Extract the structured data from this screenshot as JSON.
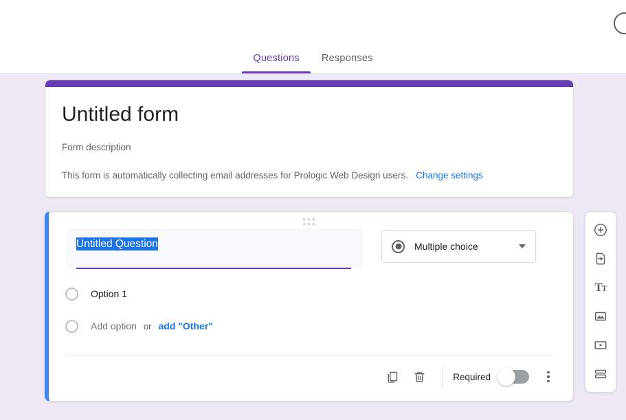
{
  "theme": {
    "accent_purple": "#673AB7",
    "accent_blue": "#4285F4",
    "link_blue": "#1a73e8",
    "page_background": "#EDE9F5"
  },
  "header": {
    "avatar_name": "account-avatar",
    "tabs": [
      {
        "label": "Questions",
        "active": true
      },
      {
        "label": "Responses",
        "active": false
      }
    ]
  },
  "form_header": {
    "title": "Untitled form",
    "description_placeholder": "Form description",
    "email_notice": "This form is automatically collecting email addresses for Prologic Web Design users.",
    "change_settings_link": "Change settings"
  },
  "question": {
    "drag_handle": "drag-handle",
    "title_text": "Untitled Question",
    "title_selected": true,
    "type": {
      "icon": "radio-button-icon",
      "label": "Multiple choice",
      "chevron": "chevron-down-icon"
    },
    "options": [
      {
        "label": "Option 1",
        "placeholder": false
      }
    ],
    "add_option": {
      "label": "Add option",
      "or": "or",
      "other_label": "add \"Other\""
    },
    "footer": {
      "duplicate_icon": "duplicate-icon",
      "delete_icon": "trash-icon",
      "required_label": "Required",
      "required_on": false,
      "more_icon": "more-vertical-icon"
    }
  },
  "side_toolbar": {
    "items": [
      {
        "name": "add-question-button",
        "icon": "plus-circle-icon"
      },
      {
        "name": "import-questions-button",
        "icon": "import-document-icon"
      },
      {
        "name": "add-title-description-button",
        "icon": "text-format-icon"
      },
      {
        "name": "add-image-button",
        "icon": "image-icon"
      },
      {
        "name": "add-video-button",
        "icon": "video-icon"
      },
      {
        "name": "add-section-button",
        "icon": "section-icon"
      }
    ]
  }
}
